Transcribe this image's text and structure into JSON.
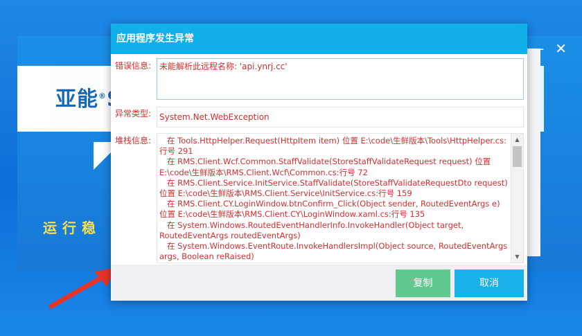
{
  "background_app": {
    "logo_text": "亚能",
    "logo_suffix": "S",
    "slogan": "运行稳",
    "controls": {
      "minimize": "—",
      "close": "✕"
    }
  },
  "dialog": {
    "title": "应用程序发生异常",
    "labels": {
      "message": "错误信息:",
      "exception_type": "异常类型:",
      "stack": "堆栈信息:"
    },
    "message": "未能解析此远程名称: 'api.ynrj.cc'",
    "exception_type": "System.Net.WebException",
    "stack_trace": "   在 Tools.HttpHelper.Request(HttpItem item) 位置 E:\\code\\生鲜版本\\Tools\\HttpHelper.cs:行号 291\n   在 RMS.Client.Wcf.Common.StaffValidate(StoreStaffValidateRequest request) 位置 E:\\code\\生鲜版本\\RMS.Client.Wcf\\Common.cs:行号 72\n   在 RMS.Client.Service.InitService.StaffValidate(StoreStaffValidateRequestDto request) 位置 E:\\code\\生鲜版本\\RMS.Client.Service\\InitService.cs:行号 159\n   在 RMS.Client.CY.LoginWindow.btnConfirm_Click(Object sender, RoutedEventArgs e) 位置 E:\\code\\生鲜版本\\RMS.Client.CY\\LoginWindow.xaml.cs:行号 135\n   在 System.Windows.RoutedEventHandlerInfo.InvokeHandler(Object target, RoutedEventArgs routedEventArgs)\n   在 System.Windows.EventRoute.InvokeHandlersImpl(Object source, RoutedEventArgs args, Boolean reRaised)",
    "buttons": {
      "copy": "复制",
      "cancel": "取消"
    }
  }
}
